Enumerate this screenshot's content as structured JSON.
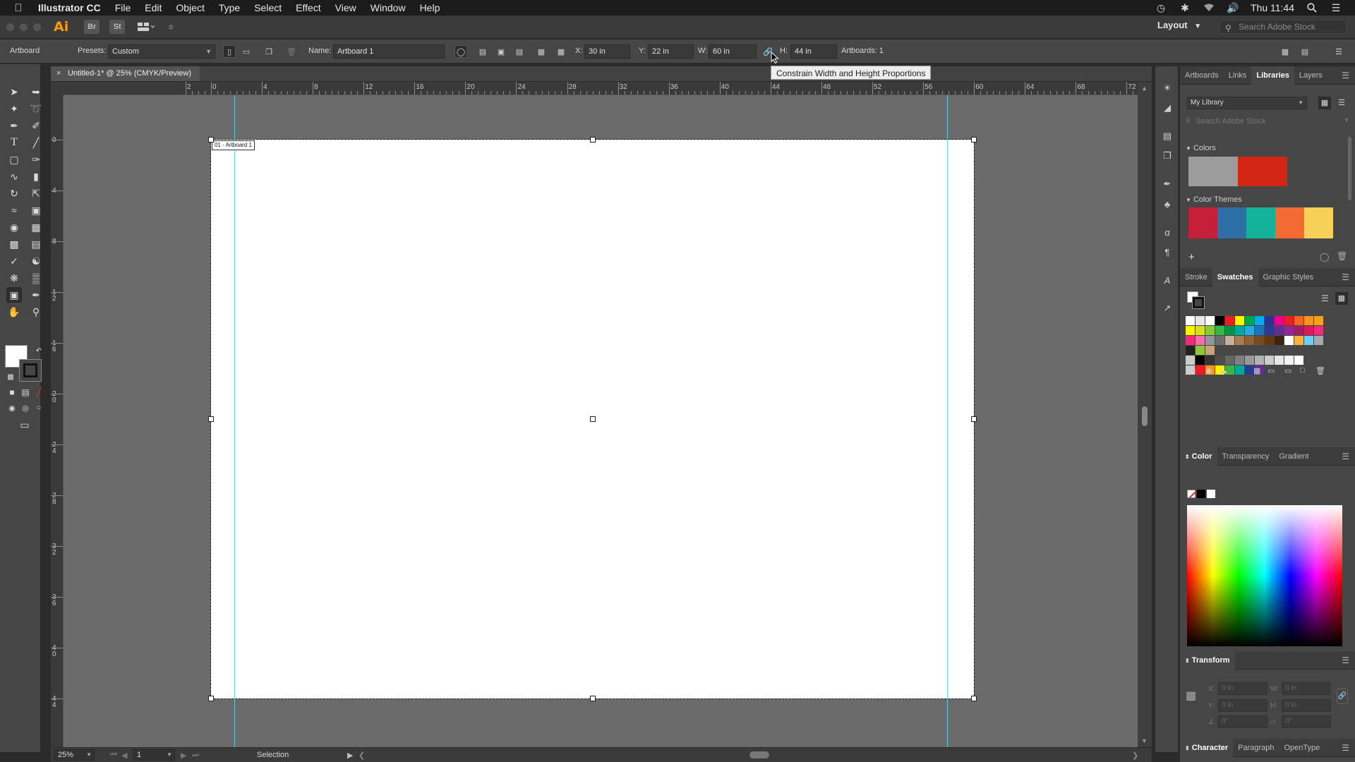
{
  "menubar": {
    "app_name": "Illustrator CC",
    "menus": [
      "File",
      "Edit",
      "Object",
      "Type",
      "Select",
      "Effect",
      "View",
      "Window",
      "Help"
    ],
    "clock": "Thu 11:44"
  },
  "appbar": {
    "logo": "Ai",
    "bridge": "Br",
    "stock": "St",
    "layout_label": "Layout",
    "search_placeholder": "Search Adobe Stock"
  },
  "controlbar": {
    "mode_label": "Artboard",
    "presets_label": "Presets:",
    "presets_value": "Custom",
    "name_label": "Name:",
    "name_value": "Artboard 1",
    "x_label": "X:",
    "x_value": "30 in",
    "y_label": "Y:",
    "y_value": "22 in",
    "w_label": "W:",
    "w_value": "60 in",
    "h_label": "H:",
    "h_value": "44 in",
    "artboards_count": "Artboards: 1",
    "tooltip": "Constrain Width and Height Proportions"
  },
  "document": {
    "tab_title": "Untitled-1* @ 25% (CMYK/Preview)",
    "artboard_label": "01 - Artboard 1"
  },
  "ruler": {
    "h_labels": [
      "2",
      "0",
      "4",
      "8",
      "12",
      "16",
      "20",
      "24",
      "28",
      "32",
      "36",
      "40",
      "44",
      "48",
      "52",
      "56",
      "60",
      "64",
      "68",
      "72"
    ],
    "v_labels": [
      "0",
      "4",
      "8",
      "12",
      "16",
      "20",
      "24",
      "28",
      "32",
      "36",
      "40",
      "44"
    ]
  },
  "statusbar": {
    "zoom": "25%",
    "artboard_nav": "1",
    "tool_status": "Selection"
  },
  "panels": {
    "top_tabs": [
      "Artboards",
      "Links",
      "Libraries",
      "Layers"
    ],
    "library_select": "My Library",
    "library_search_placeholder": "Search Adobe Stock",
    "colors_header": "Colors",
    "themes_header": "Color Themes",
    "theme_colors": [
      "#c4203a",
      "#2d6fa6",
      "#12b39a",
      "#f26a32",
      "#f7d057"
    ],
    "swatch_tabs": [
      "Stroke",
      "Swatches",
      "Graphic Styles"
    ],
    "color_tabs": [
      "Color",
      "Transparency",
      "Gradient"
    ],
    "transform_title": "Transform",
    "transform_fields": {
      "x_label": "X:",
      "x_value": "0 in",
      "y_label": "Y:",
      "y_value": "0 in",
      "w_label": "W:",
      "w_value": "0 in",
      "h_label": "H:",
      "h_value": "0 in",
      "angle_value": "0°",
      "shear_value": "0°"
    },
    "character_tabs": [
      "Character",
      "Paragraph",
      "OpenType"
    ]
  }
}
